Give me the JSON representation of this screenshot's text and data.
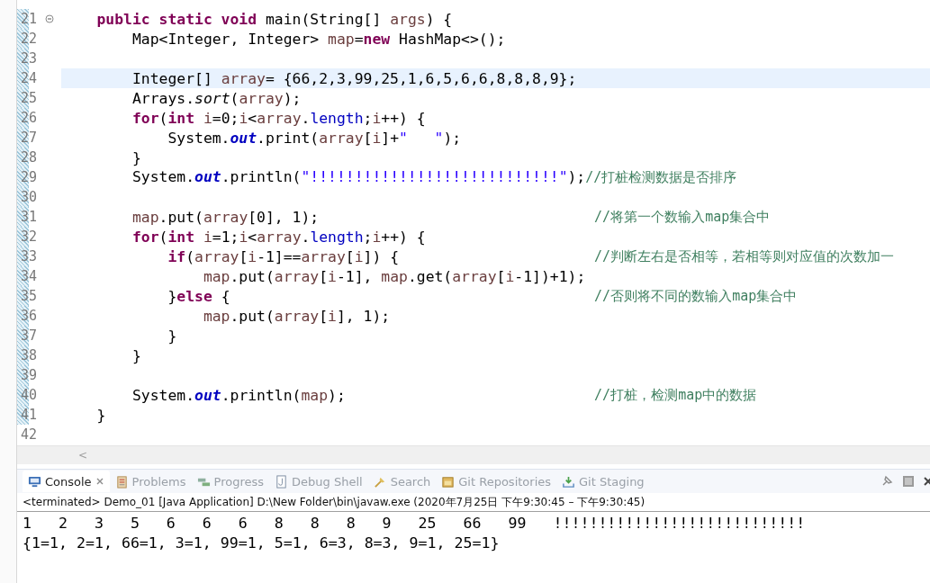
{
  "editor": {
    "lines": [
      {
        "number": "21",
        "fold": true,
        "current": false,
        "changed": true,
        "tokens": [
          {
            "kind": "keyword",
            "text": "    public static void"
          },
          {
            "kind": "plain",
            "text": " main(String[] "
          },
          {
            "kind": "local",
            "text": "args"
          },
          {
            "kind": "plain",
            "text": ") {"
          }
        ]
      },
      {
        "number": "22",
        "fold": false,
        "current": false,
        "changed": true,
        "tokens": [
          {
            "kind": "plain",
            "text": "        Map<Integer, Integer> "
          },
          {
            "kind": "local",
            "text": "map"
          },
          {
            "kind": "plain",
            "text": "="
          },
          {
            "kind": "keyword",
            "text": "new"
          },
          {
            "kind": "plain",
            "text": " HashMap<>();"
          }
        ]
      },
      {
        "number": "23",
        "fold": false,
        "current": false,
        "changed": true
      },
      {
        "number": "24",
        "fold": false,
        "current": true,
        "changed": true,
        "tokens": [
          {
            "kind": "plain",
            "text": "        Integer[] "
          },
          {
            "kind": "local",
            "text": "array"
          },
          {
            "kind": "plain",
            "text": "= {66,2,3,99,25,1,6,5,6,6,8,8,8,9};"
          }
        ]
      },
      {
        "number": "25",
        "fold": false,
        "current": false,
        "changed": true,
        "tokens": [
          {
            "kind": "plain",
            "text": "        Arrays."
          },
          {
            "kind": "static_method",
            "text": "sort"
          },
          {
            "kind": "plain",
            "text": "("
          },
          {
            "kind": "local",
            "text": "array"
          },
          {
            "kind": "plain",
            "text": ");"
          }
        ]
      },
      {
        "number": "26",
        "fold": false,
        "current": false,
        "changed": true,
        "tokens": [
          {
            "kind": "keyword",
            "text": "        for"
          },
          {
            "kind": "plain",
            "text": "("
          },
          {
            "kind": "keyword",
            "text": "int"
          },
          {
            "kind": "local",
            "text": " i"
          },
          {
            "kind": "plain",
            "text": "=0;"
          },
          {
            "kind": "local",
            "text": "i"
          },
          {
            "kind": "plain",
            "text": "<"
          },
          {
            "kind": "local",
            "text": "array"
          },
          {
            "kind": "plain",
            "text": "."
          },
          {
            "kind": "field",
            "text": "length"
          },
          {
            "kind": "plain",
            "text": ";"
          },
          {
            "kind": "local",
            "text": "i"
          },
          {
            "kind": "plain",
            "text": "++) {"
          }
        ]
      },
      {
        "number": "27",
        "fold": false,
        "current": false,
        "changed": true,
        "tokens": [
          {
            "kind": "plain",
            "text": "            System."
          },
          {
            "kind": "static_field",
            "text": "out"
          },
          {
            "kind": "plain",
            "text": ".print("
          },
          {
            "kind": "local",
            "text": "array"
          },
          {
            "kind": "plain",
            "text": "["
          },
          {
            "kind": "local",
            "text": "i"
          },
          {
            "kind": "plain",
            "text": "]+"
          },
          {
            "kind": "string",
            "text": "\"   \""
          },
          {
            "kind": "plain",
            "text": ");"
          }
        ]
      },
      {
        "number": "28",
        "fold": false,
        "current": false,
        "changed": true,
        "tokens": [
          {
            "kind": "plain",
            "text": "        }"
          }
        ]
      },
      {
        "number": "29",
        "fold": false,
        "current": false,
        "changed": true,
        "tokens": [
          {
            "kind": "plain",
            "text": "        System."
          },
          {
            "kind": "static_field",
            "text": "out"
          },
          {
            "kind": "plain",
            "text": ".println("
          },
          {
            "kind": "string",
            "text": "\"!!!!!!!!!!!!!!!!!!!!!!!!!!!!\""
          },
          {
            "kind": "plain",
            "text": ");"
          },
          {
            "kind": "comment",
            "text": "//打桩检测数据是否排序"
          }
        ]
      },
      {
        "number": "30",
        "fold": false,
        "current": false,
        "changed": true
      },
      {
        "number": "31",
        "fold": false,
        "current": false,
        "changed": true,
        "tokens": [
          {
            "kind": "local",
            "text": "        map"
          },
          {
            "kind": "plain",
            "text": ".put("
          },
          {
            "kind": "local",
            "text": "array"
          },
          {
            "kind": "plain",
            "text": "[0], 1);"
          }
        ],
        "comment": "//将第一个数输入map集合中"
      },
      {
        "number": "32",
        "fold": false,
        "current": false,
        "changed": true,
        "tokens": [
          {
            "kind": "keyword",
            "text": "        for"
          },
          {
            "kind": "plain",
            "text": "("
          },
          {
            "kind": "keyword",
            "text": "int"
          },
          {
            "kind": "local",
            "text": " i"
          },
          {
            "kind": "plain",
            "text": "=1;"
          },
          {
            "kind": "local",
            "text": "i"
          },
          {
            "kind": "plain",
            "text": "<"
          },
          {
            "kind": "local",
            "text": "array"
          },
          {
            "kind": "plain",
            "text": "."
          },
          {
            "kind": "field",
            "text": "length"
          },
          {
            "kind": "plain",
            "text": ";"
          },
          {
            "kind": "local",
            "text": "i"
          },
          {
            "kind": "plain",
            "text": "++) {"
          }
        ]
      },
      {
        "number": "33",
        "fold": false,
        "current": false,
        "changed": true,
        "tokens": [
          {
            "kind": "keyword",
            "text": "            if"
          },
          {
            "kind": "plain",
            "text": "("
          },
          {
            "kind": "local",
            "text": "array"
          },
          {
            "kind": "plain",
            "text": "["
          },
          {
            "kind": "local",
            "text": "i"
          },
          {
            "kind": "plain",
            "text": "-1]=="
          },
          {
            "kind": "local",
            "text": "array"
          },
          {
            "kind": "plain",
            "text": "["
          },
          {
            "kind": "local",
            "text": "i"
          },
          {
            "kind": "plain",
            "text": "]) {"
          }
        ],
        "comment": "//判断左右是否相等，若相等则对应值的次数加一"
      },
      {
        "number": "34",
        "fold": false,
        "current": false,
        "changed": true,
        "tokens": [
          {
            "kind": "local",
            "text": "                map"
          },
          {
            "kind": "plain",
            "text": ".put("
          },
          {
            "kind": "local",
            "text": "array"
          },
          {
            "kind": "plain",
            "text": "["
          },
          {
            "kind": "local",
            "text": "i"
          },
          {
            "kind": "plain",
            "text": "-1], "
          },
          {
            "kind": "local",
            "text": "map"
          },
          {
            "kind": "plain",
            "text": ".get("
          },
          {
            "kind": "local",
            "text": "array"
          },
          {
            "kind": "plain",
            "text": "["
          },
          {
            "kind": "local",
            "text": "i"
          },
          {
            "kind": "plain",
            "text": "-1])+1);"
          }
        ]
      },
      {
        "number": "35",
        "fold": false,
        "current": false,
        "changed": true,
        "tokens": [
          {
            "kind": "plain",
            "text": "            }"
          },
          {
            "kind": "keyword",
            "text": "else"
          },
          {
            "kind": "plain",
            "text": " {"
          }
        ],
        "comment": "//否则将不同的数输入map集合中"
      },
      {
        "number": "36",
        "fold": false,
        "current": false,
        "changed": true,
        "tokens": [
          {
            "kind": "local",
            "text": "                map"
          },
          {
            "kind": "plain",
            "text": ".put("
          },
          {
            "kind": "local",
            "text": "array"
          },
          {
            "kind": "plain",
            "text": "["
          },
          {
            "kind": "local",
            "text": "i"
          },
          {
            "kind": "plain",
            "text": "], 1);"
          }
        ]
      },
      {
        "number": "37",
        "fold": false,
        "current": false,
        "changed": true,
        "tokens": [
          {
            "kind": "plain",
            "text": "            }"
          }
        ]
      },
      {
        "number": "38",
        "fold": false,
        "current": false,
        "changed": true,
        "tokens": [
          {
            "kind": "plain",
            "text": "        }"
          }
        ]
      },
      {
        "number": "39",
        "fold": false,
        "current": false,
        "changed": true
      },
      {
        "number": "40",
        "fold": false,
        "current": false,
        "changed": true,
        "tokens": [
          {
            "kind": "plain",
            "text": "        System."
          },
          {
            "kind": "static_field",
            "text": "out"
          },
          {
            "kind": "plain",
            "text": ".println("
          },
          {
            "kind": "local",
            "text": "map"
          },
          {
            "kind": "plain",
            "text": ");"
          }
        ],
        "comment": "//打桩，检测map中的数据"
      },
      {
        "number": "41",
        "fold": false,
        "current": false,
        "changed": true,
        "tokens": [
          {
            "kind": "plain",
            "text": "    }"
          }
        ]
      },
      {
        "number": "42",
        "fold": false,
        "current": false,
        "changed": false
      }
    ],
    "scroll_arrow": "<"
  },
  "console": {
    "tabs": [
      {
        "label": "Console",
        "selected": true
      },
      {
        "label": "Problems",
        "selected": false
      },
      {
        "label": "Progress",
        "selected": false
      },
      {
        "label": "Debug Shell",
        "selected": false
      },
      {
        "label": "Search",
        "selected": false
      },
      {
        "label": "Git Repositories",
        "selected": false
      },
      {
        "label": "Git Staging",
        "selected": false
      }
    ],
    "status": "<terminated> Demo_01 [Java Application] D:\\New Folder\\bin\\javaw.exe  (2020年7月25日 下午9:30:45 – 下午9:30:45)",
    "output": [
      "1   2   3   5   6   6   6   8   8   8   9   25   66   99   !!!!!!!!!!!!!!!!!!!!!!!!!!!!",
      "{1=1, 2=1, 66=1, 3=1, 99=1, 5=1, 6=3, 8=3, 9=1, 25=1}"
    ]
  }
}
